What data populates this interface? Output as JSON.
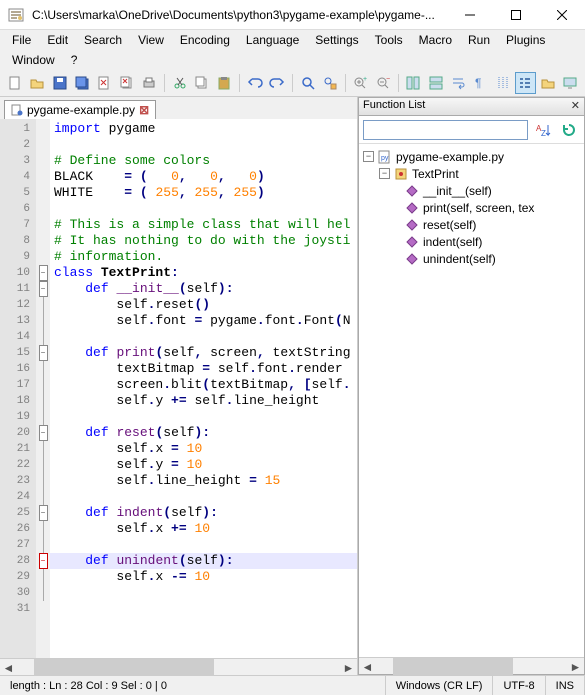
{
  "title": "C:\\Users\\marka\\OneDrive\\Documents\\python3\\pygame-example\\pygame-...",
  "menu": [
    "File",
    "Edit",
    "Search",
    "View",
    "Encoding",
    "Language",
    "Settings",
    "Tools",
    "Macro",
    "Run",
    "Plugins",
    "Window",
    "?"
  ],
  "tab": {
    "label": "pygame-example.py",
    "close": "⊠"
  },
  "code": {
    "lines": [
      {
        "n": 1,
        "fold": "",
        "html": "<span class='kw'>import</span> pygame"
      },
      {
        "n": 2,
        "fold": "",
        "html": ""
      },
      {
        "n": 3,
        "fold": "",
        "html": "<span class='cmt'># Define some colors</span>"
      },
      {
        "n": 4,
        "fold": "",
        "html": "BLACK    <span class='op'>=</span> <span class='op'>(</span>   <span class='num'>0</span><span class='op'>,</span>   <span class='num'>0</span><span class='op'>,</span>   <span class='num'>0</span><span class='op'>)</span>"
      },
      {
        "n": 5,
        "fold": "",
        "html": "WHITE    <span class='op'>=</span> <span class='op'>(</span> <span class='num'>255</span><span class='op'>,</span> <span class='num'>255</span><span class='op'>,</span> <span class='num'>255</span><span class='op'>)</span>"
      },
      {
        "n": 6,
        "fold": "",
        "html": ""
      },
      {
        "n": 7,
        "fold": "",
        "html": "<span class='cmt'># This is a simple class that will hel</span>"
      },
      {
        "n": 8,
        "fold": "",
        "html": "<span class='cmt'># It has nothing to do with the joysti</span>"
      },
      {
        "n": 9,
        "fold": "",
        "html": "<span class='cmt'># information.</span>"
      },
      {
        "n": 10,
        "fold": "minus",
        "html": "<span class='kw'>class</span> <span class='cls'>TextPrint</span><span class='op'>:</span>"
      },
      {
        "n": 11,
        "fold": "minus",
        "html": "    <span class='kw'>def</span> <span class='fn'>__init__</span><span class='op'>(</span>self<span class='op'>):</span>"
      },
      {
        "n": 12,
        "fold": "line",
        "html": "        self<span class='op'>.</span>reset<span class='op'>()</span>"
      },
      {
        "n": 13,
        "fold": "line",
        "html": "        self<span class='op'>.</span>font <span class='op'>=</span> pygame<span class='op'>.</span>font<span class='op'>.</span>Font<span class='op'>(</span>N"
      },
      {
        "n": 14,
        "fold": "line",
        "html": ""
      },
      {
        "n": 15,
        "fold": "minus",
        "html": "    <span class='kw'>def</span> <span class='fn'>print</span><span class='op'>(</span>self<span class='op'>,</span> screen<span class='op'>,</span> textString"
      },
      {
        "n": 16,
        "fold": "line",
        "html": "        textBitmap <span class='op'>=</span> self<span class='op'>.</span>font<span class='op'>.</span>render"
      },
      {
        "n": 17,
        "fold": "line",
        "html": "        screen<span class='op'>.</span>blit<span class='op'>(</span>textBitmap<span class='op'>,</span> <span class='op'>[</span>self<span class='op'>.</span>"
      },
      {
        "n": 18,
        "fold": "line",
        "html": "        self<span class='op'>.</span>y <span class='op'>+=</span> self<span class='op'>.</span>line_height"
      },
      {
        "n": 19,
        "fold": "line",
        "html": ""
      },
      {
        "n": 20,
        "fold": "minus",
        "html": "    <span class='kw'>def</span> <span class='fn'>reset</span><span class='op'>(</span>self<span class='op'>):</span>"
      },
      {
        "n": 21,
        "fold": "line",
        "html": "        self<span class='op'>.</span>x <span class='op'>=</span> <span class='num'>10</span>"
      },
      {
        "n": 22,
        "fold": "line",
        "html": "        self<span class='op'>.</span>y <span class='op'>=</span> <span class='num'>10</span>"
      },
      {
        "n": 23,
        "fold": "line",
        "html": "        self<span class='op'>.</span>line_height <span class='op'>=</span> <span class='num'>15</span>"
      },
      {
        "n": 24,
        "fold": "line",
        "html": ""
      },
      {
        "n": 25,
        "fold": "minus",
        "html": "    <span class='kw'>def</span> <span class='fn'>indent</span><span class='op'>(</span>self<span class='op'>):</span>"
      },
      {
        "n": 26,
        "fold": "line",
        "html": "        self<span class='op'>.</span>x <span class='op'>+=</span> <span class='num'>10</span>"
      },
      {
        "n": 27,
        "fold": "line",
        "html": ""
      },
      {
        "n": 28,
        "fold": "minus-red",
        "hl": true,
        "html": "    <span class='kw'>def</span> <span class='fn'>unindent</span><span class='op'>(</span>self<span class='op'>):</span>"
      },
      {
        "n": 29,
        "fold": "line",
        "html": "        self<span class='op'>.</span>x <span class='op'>-=</span> <span class='num'>10</span>"
      },
      {
        "n": 30,
        "fold": "line",
        "html": ""
      },
      {
        "n": 31,
        "fold": "",
        "html": ""
      }
    ]
  },
  "funclist": {
    "title": "Function List",
    "search_placeholder": "",
    "root": "pygame-example.py",
    "class": "TextPrint",
    "methods": [
      "__init__(self)",
      "print(self, screen, tex",
      "reset(self)",
      "indent(self)",
      "unindent(self)"
    ]
  },
  "status": {
    "pos": "length :  Ln : 28    Col : 9    Sel : 0 | 0",
    "eol": "Windows (CR LF)",
    "enc": "UTF-8",
    "mode": "INS"
  }
}
